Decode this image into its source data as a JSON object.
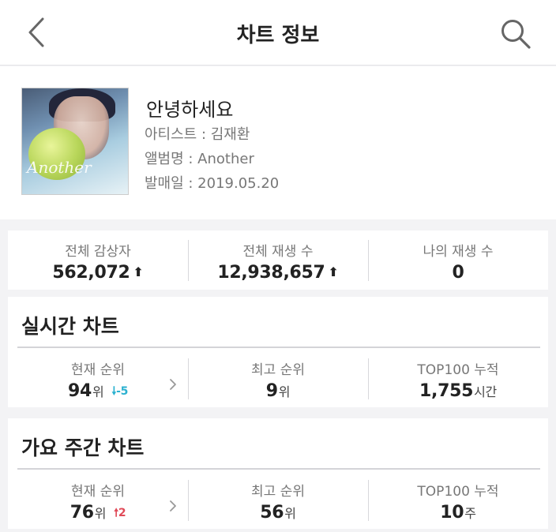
{
  "header": {
    "title": "차트 정보"
  },
  "song": {
    "title": "안녕하세요",
    "artist_line": "아티스트 : 김재환",
    "album_line": "앨범명 : Another",
    "release_line": "발매일 : 2019.05.20",
    "cover_script": "Another"
  },
  "stats": {
    "listeners_label": "전체 감상자",
    "listeners_value": "562,072",
    "plays_label": "전체 재생 수",
    "plays_value": "12,938,657",
    "my_plays_label": "나의 재생 수",
    "my_plays_value": "0"
  },
  "realtime": {
    "title": "실시간 차트",
    "current_label": "현재 순위",
    "current_rank": "94",
    "rank_unit": "위",
    "change": "-5",
    "change_direction": "down",
    "best_label": "최고 순위",
    "best_rank": "9",
    "top100_label": "TOP100 누적",
    "top100_value": "1,755",
    "top100_unit": "시간"
  },
  "weekly": {
    "title": "가요 주간 차트",
    "current_label": "현재 순위",
    "current_rank": "76",
    "rank_unit": "위",
    "change": "2",
    "change_direction": "up",
    "best_label": "최고 순위",
    "best_rank": "56",
    "top100_label": "TOP100 누적",
    "top100_value": "10",
    "top100_unit": "주"
  },
  "icons": {
    "back": "chevron-left-icon",
    "search": "search-icon",
    "expand": "chevron-right-icon",
    "up": "arrow-up-icon",
    "down": "arrow-down-icon"
  },
  "colors": {
    "down": "#2bb1d0",
    "up": "#e04a58"
  }
}
